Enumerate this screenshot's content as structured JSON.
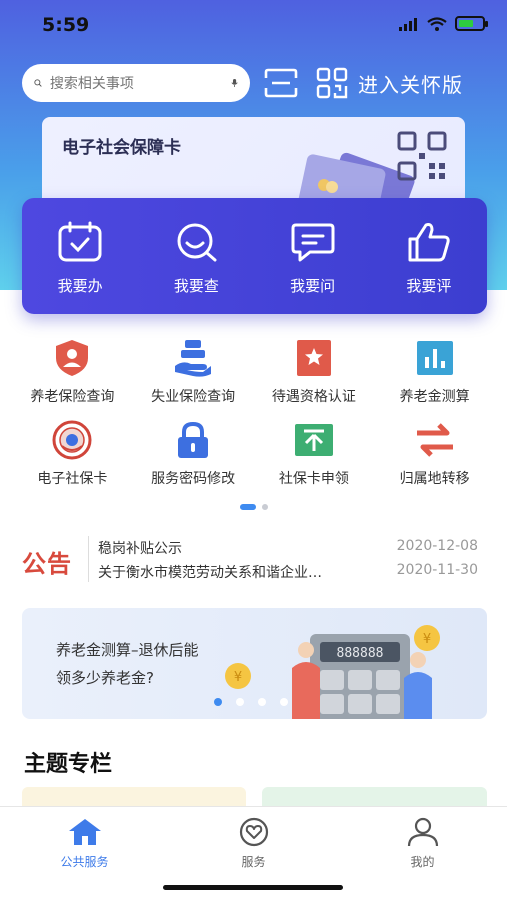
{
  "status_bar": {
    "time": "5:59"
  },
  "search": {
    "placeholder": "搜索相关事项"
  },
  "care_mode": {
    "label": "进入关怀版"
  },
  "card": {
    "title": "电子社会保障卡"
  },
  "quick_actions": [
    {
      "label": "我要办",
      "icon": "calendar-check-icon"
    },
    {
      "label": "我要查",
      "icon": "search-smile-icon"
    },
    {
      "label": "我要问",
      "icon": "chat-bubble-icon"
    },
    {
      "label": "我要评",
      "icon": "thumbs-up-icon"
    }
  ],
  "services": [
    {
      "label": "养老保险查询",
      "icon": "shield-user-icon",
      "color": "#e05a4a"
    },
    {
      "label": "失业保险查询",
      "icon": "hand-coin-icon",
      "color": "#3d6fe0"
    },
    {
      "label": "待遇资格认证",
      "icon": "star-badge-icon",
      "color": "#e05a4a"
    },
    {
      "label": "养老金测算",
      "icon": "bar-chart-icon",
      "color": "#3aa3d6"
    },
    {
      "label": "电子社保卡",
      "icon": "emblem-icon",
      "color": "#d0453a"
    },
    {
      "label": "服务密码修改",
      "icon": "lock-icon",
      "color": "#3d6fe0"
    },
    {
      "label": "社保卡申领",
      "icon": "upload-card-icon",
      "color": "#3dae72"
    },
    {
      "label": "归属地转移",
      "icon": "transfer-arrows-icon",
      "color": "#e05a4a"
    }
  ],
  "notice": {
    "tag": "公告",
    "items": [
      {
        "title": "稳岗补贴公示",
        "date": "2020-12-08"
      },
      {
        "title": "关于衡水市模范劳动关系和谐企业…",
        "date": "2020-11-30"
      }
    ]
  },
  "banner": {
    "line1": "养老金测算–退休后能",
    "line2": "领多少养老金?",
    "calculator_display": "888888"
  },
  "section": {
    "title": "主题专栏"
  },
  "tabs": [
    {
      "label": "公共服务",
      "icon": "home-icon",
      "active": true
    },
    {
      "label": "服务",
      "icon": "heart-circle-icon",
      "active": false
    },
    {
      "label": "我的",
      "icon": "person-icon",
      "active": false
    }
  ],
  "colors": {
    "accent": "#3e7be9",
    "quick_bg": "#4541d8",
    "notice_red": "#d84a3d"
  }
}
